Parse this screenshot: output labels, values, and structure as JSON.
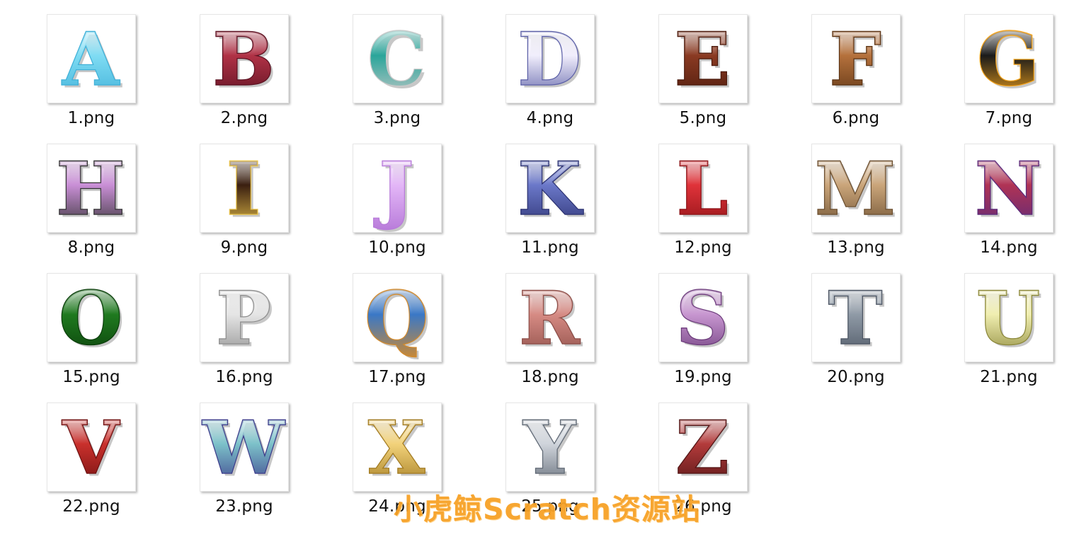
{
  "files": [
    {
      "name": "1.png",
      "glyph": "A",
      "fill": "#7fdcf3",
      "stroke": "#3fb0d8",
      "bg": "#ffffff",
      "icon": "letter-a-glow-image"
    },
    {
      "name": "2.png",
      "glyph": "B",
      "fill": "#b03246",
      "stroke": "#5a1020",
      "bg": "#ffffff",
      "icon": "letter-b-glitter-image"
    },
    {
      "name": "3.png",
      "glyph": "C",
      "fill": "#2aa59a",
      "stroke": "#c9c9c9",
      "bg": "#ffffff",
      "icon": "letter-c-teal-image"
    },
    {
      "name": "4.png",
      "glyph": "D",
      "fill": "#f1eefc",
      "stroke": "#5b5fa6",
      "bg": "#ffffff",
      "icon": "letter-d-outline-image"
    },
    {
      "name": "5.png",
      "glyph": "E",
      "fill": "#8a3a22",
      "stroke": "#4b1a0c",
      "bg": "#ffffff",
      "icon": "letter-e-ornate-image"
    },
    {
      "name": "6.png",
      "glyph": "F",
      "fill": "#b5713c",
      "stroke": "#5a3213",
      "bg": "#ffffff",
      "icon": "letter-f-copper-image"
    },
    {
      "name": "7.png",
      "glyph": "G",
      "fill": "#1a1a1a",
      "stroke": "#f7a51b",
      "bg": "#ffffff",
      "icon": "letter-g-flame-image"
    },
    {
      "name": "8.png",
      "glyph": "H",
      "fill": "#c98fd6",
      "stroke": "#333333",
      "bg": "#ffffff",
      "icon": "letter-h-mosaic-image"
    },
    {
      "name": "9.png",
      "glyph": "I",
      "fill": "#3a1f10",
      "stroke": "#e8c24a",
      "bg": "#ffffff",
      "icon": "letter-i-neon-image"
    },
    {
      "name": "10.png",
      "glyph": "J",
      "fill": "#e3b6f7",
      "stroke": "#b77ad9",
      "bg": "#ffffff",
      "icon": "letter-j-lilac-image"
    },
    {
      "name": "11.png",
      "glyph": "K",
      "fill": "#6b78c9",
      "stroke": "#2b3170",
      "bg": "#ffffff",
      "icon": "letter-k-flowers-image"
    },
    {
      "name": "12.png",
      "glyph": "L",
      "fill": "#e0333a",
      "stroke": "#8a1014",
      "bg": "#ffffff",
      "icon": "letter-l-red-image"
    },
    {
      "name": "13.png",
      "glyph": "M",
      "fill": "#caa57a",
      "stroke": "#6a4d2e",
      "bg": "#ffffff",
      "icon": "letter-m-rock-image"
    },
    {
      "name": "14.png",
      "glyph": "N",
      "fill": "#b03355",
      "stroke": "#5a2a7a",
      "bg": "#ffffff",
      "icon": "letter-n-crumble-image"
    },
    {
      "name": "15.png",
      "glyph": "O",
      "fill": "#1f7a1f",
      "stroke": "#0a3d0a",
      "bg": "#ffffff",
      "icon": "letter-o-green-image"
    },
    {
      "name": "16.png",
      "glyph": "P",
      "fill": "#e5e5e5",
      "stroke": "#8c8c8c",
      "bg": "#ffffff",
      "icon": "letter-p-silver-image"
    },
    {
      "name": "17.png",
      "glyph": "Q",
      "fill": "#3a78c6",
      "stroke": "#d48a2a",
      "bg": "#ffffff",
      "icon": "letter-q-chrome-image"
    },
    {
      "name": "18.png",
      "glyph": "R",
      "fill": "#d68b84",
      "stroke": "#8a4b45",
      "bg": "#ffffff",
      "icon": "letter-r-knit-image"
    },
    {
      "name": "19.png",
      "glyph": "S",
      "fill": "#c796d0",
      "stroke": "#6b3a7a",
      "bg": "#ffffff",
      "icon": "letter-s-blossom-image"
    },
    {
      "name": "20.png",
      "glyph": "T",
      "fill": "#8f9aa6",
      "stroke": "#4a5361",
      "bg": "#ffffff",
      "icon": "letter-t-steel-image"
    },
    {
      "name": "21.png",
      "glyph": "U",
      "fill": "#f0eeb0",
      "stroke": "#8a8638",
      "bg": "#ffffff",
      "icon": "letter-u-cream-image"
    },
    {
      "name": "22.png",
      "glyph": "V",
      "fill": "#c9302c",
      "stroke": "#6e1010",
      "bg": "#ffffff",
      "icon": "letter-v-red-image"
    },
    {
      "name": "23.png",
      "glyph": "W",
      "fill": "#7cc1c9",
      "stroke": "#3b3b8a",
      "bg": "#ffffff",
      "icon": "letter-w-rainbow-image"
    },
    {
      "name": "24.png",
      "glyph": "X",
      "fill": "#f2d27a",
      "stroke": "#a0781e",
      "bg": "#ffffff",
      "icon": "letter-x-gold-image"
    },
    {
      "name": "25.png",
      "glyph": "Y",
      "fill": "#cfd4db",
      "stroke": "#5d6672",
      "bg": "#ffffff",
      "icon": "letter-y-pewter-image"
    },
    {
      "name": "26.png",
      "glyph": "Z",
      "fill": "#b33b3b",
      "stroke": "#501313",
      "bg": "#ffffff",
      "icon": "letter-z-ornate-image"
    }
  ],
  "watermark": {
    "text": "小虎鲸Scratch资源站",
    "color": "#f7a227"
  }
}
